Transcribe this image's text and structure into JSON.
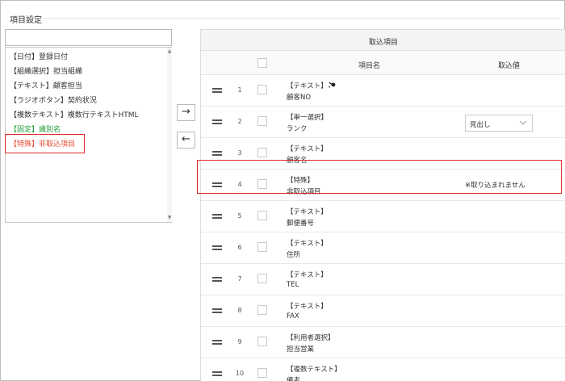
{
  "section_title": "項目設定",
  "search": {
    "value": "",
    "placeholder": ""
  },
  "available_items": [
    {
      "label": "【日付】登録日付",
      "style": "normal"
    },
    {
      "label": "【組織選択】担当組織",
      "style": "normal"
    },
    {
      "label": "【テキスト】顧客担当",
      "style": "normal"
    },
    {
      "label": "【ラジオボタン】契約状況",
      "style": "normal"
    },
    {
      "label": "【複数テキスト】複数行テキストHTML",
      "style": "normal"
    },
    {
      "label": "【固定】識別名",
      "style": "green"
    },
    {
      "label": "【特殊】非取込項目",
      "style": "red",
      "selected": true
    }
  ],
  "buttons": {
    "add_arrow": "→",
    "remove_arrow": "←"
  },
  "table": {
    "group_header": "取込項目",
    "col_name": "項目名",
    "col_value": "取込値",
    "rows": [
      {
        "num": "1",
        "type": "【テキスト】",
        "name": "顧客NO",
        "key_icon": "key-icon",
        "value": ""
      },
      {
        "num": "2",
        "type": "【単一選択】",
        "name": "ランク",
        "value_select": "見出し"
      },
      {
        "num": "3",
        "type": "【テキスト】",
        "name": "顧客名",
        "value": ""
      },
      {
        "num": "4",
        "type": "【特殊】",
        "name": "非取込項目",
        "value_note": "※取り込まれません",
        "highlighted": true
      },
      {
        "num": "5",
        "type": "【テキスト】",
        "name": "郵便番号",
        "value": ""
      },
      {
        "num": "6",
        "type": "【テキスト】",
        "name": "住所",
        "value": ""
      },
      {
        "num": "7",
        "type": "【テキスト】",
        "name": "TEL",
        "value": ""
      },
      {
        "num": "8",
        "type": "【テキスト】",
        "name": "FAX",
        "value": ""
      },
      {
        "num": "9",
        "type": "【利用者選択】",
        "name": "担当営業",
        "value": ""
      },
      {
        "num": "10",
        "type": "【複数テキスト】",
        "name": "備考",
        "value": ""
      }
    ]
  },
  "colors": {
    "highlight": "#e0262a",
    "green_item": "#1f9d3a",
    "red_item": "#e8472c"
  }
}
